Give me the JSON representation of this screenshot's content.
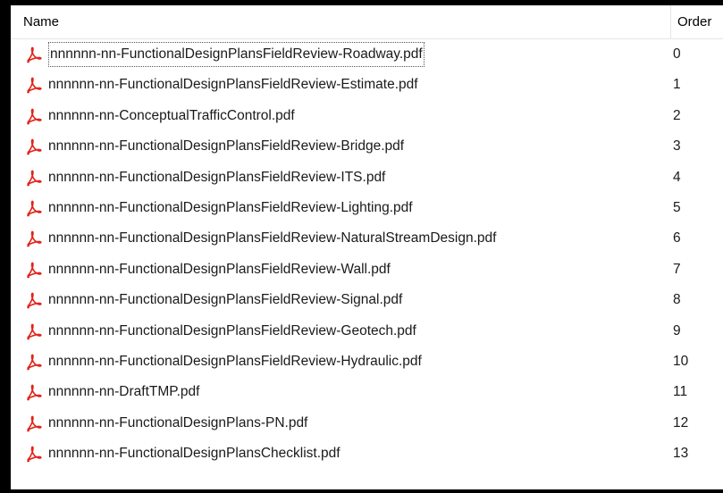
{
  "columns": {
    "name": "Name",
    "order": "Order"
  },
  "rows": [
    {
      "name": "nnnnnn-nn-FunctionalDesignPlansFieldReview-Roadway.pdf",
      "order": "0"
    },
    {
      "name": "nnnnnn-nn-FunctionalDesignPlansFieldReview-Estimate.pdf",
      "order": "1"
    },
    {
      "name": "nnnnnn-nn-ConceptualTrafficControl.pdf",
      "order": "2"
    },
    {
      "name": "nnnnnn-nn-FunctionalDesignPlansFieldReview-Bridge.pdf",
      "order": "3"
    },
    {
      "name": "nnnnnn-nn-FunctionalDesignPlansFieldReview-ITS.pdf",
      "order": "4"
    },
    {
      "name": "nnnnnn-nn-FunctionalDesignPlansFieldReview-Lighting.pdf",
      "order": "5"
    },
    {
      "name": "nnnnnn-nn-FunctionalDesignPlansFieldReview-NaturalStreamDesign.pdf",
      "order": "6"
    },
    {
      "name": "nnnnnn-nn-FunctionalDesignPlansFieldReview-Wall.pdf",
      "order": "7"
    },
    {
      "name": "nnnnnn-nn-FunctionalDesignPlansFieldReview-Signal.pdf",
      "order": "8"
    },
    {
      "name": "nnnnnn-nn-FunctionalDesignPlansFieldReview-Geotech.pdf",
      "order": "9"
    },
    {
      "name": "nnnnnn-nn-FunctionalDesignPlansFieldReview-Hydraulic.pdf",
      "order": "10"
    },
    {
      "name": "nnnnnn-nn-DraftTMP.pdf",
      "order": "11"
    },
    {
      "name": "nnnnnn-nn-FunctionalDesignPlans-PN.pdf",
      "order": "12"
    },
    {
      "name": "nnnnnn-nn-FunctionalDesignPlansChecklist.pdf",
      "order": "13"
    }
  ],
  "icon": {
    "name": "pdf-file-icon",
    "color": "#e2231a"
  }
}
